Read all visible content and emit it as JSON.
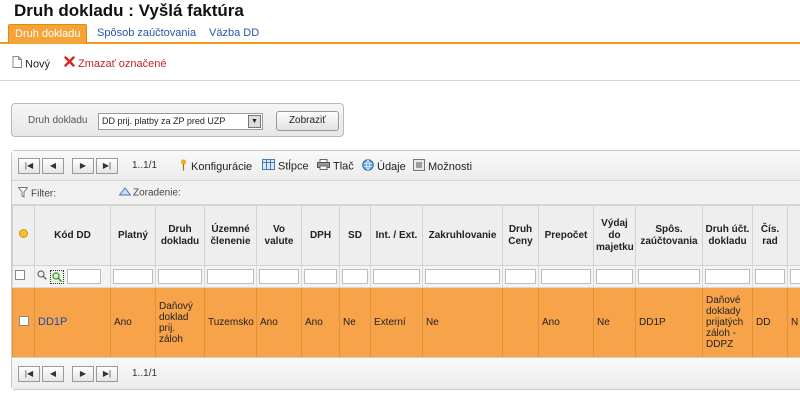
{
  "page": {
    "title": "Druh dokladu : Vyšlá faktúra"
  },
  "tabs": [
    {
      "label": "Druh dokladu",
      "active": true
    },
    {
      "label": "Spôsob zaúčtovania",
      "active": false
    },
    {
      "label": "Väzba DD",
      "active": false
    }
  ],
  "actions": {
    "new_label": "Nový",
    "delete_label": "Zmazať označené"
  },
  "filter": {
    "label": "Druh dokladu",
    "selected_value": "DD prij. platby za ZP pred UZP",
    "show_button": "Zobraziť"
  },
  "pager": {
    "first": "|◀",
    "prev": "◀",
    "next": "▶",
    "last": "▶|",
    "info": "1..1/1"
  },
  "toolbar": {
    "config": "Konfigurácie",
    "columns": "Stĺpce",
    "print": "Tlač",
    "data": "Údaje",
    "options": "Možnosti"
  },
  "subbar": {
    "filter": "Filter:",
    "sort": "Zoradenie:"
  },
  "grid": {
    "columns": [
      "",
      "Kód DD",
      "Platný",
      "Druh dokladu",
      "Územné členenie",
      "Vo valute",
      "DPH",
      "SD",
      "Int. / Ext.",
      "Zakruhlovanie",
      "Druh Ceny",
      "Prepočet",
      "Výdaj do majetku",
      "Spôs. zaúčtovania",
      "Druh účt. dokladu",
      "Čís. rad",
      ""
    ],
    "rows": [
      {
        "cells": [
          "",
          "DD1P",
          "Ano",
          "Daňový doklad prij. záloh",
          "Tuzemsko",
          "Ano",
          "Ano",
          "Ne",
          "Externí",
          "Ne",
          "",
          "Ano",
          "Ne",
          "DD1P",
          "Daňové doklady prijatých záloh - DDPZ",
          "DD",
          "N"
        ]
      }
    ]
  },
  "colors": {
    "accent": "#f29a1a",
    "row_highlight": "#f7a34a",
    "link": "#2457a6"
  }
}
